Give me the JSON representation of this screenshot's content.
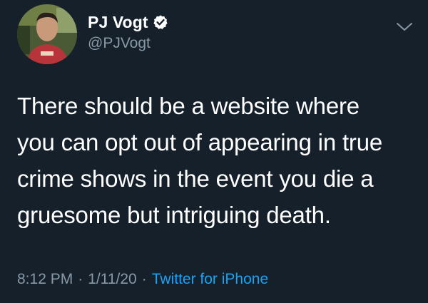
{
  "tweet": {
    "author": {
      "display_name": "PJ Vogt",
      "handle": "@PJVogt",
      "verified": true,
      "avatar_icon": "profile-photo"
    },
    "text_lines": [
      "There should be a website where",
      "you can opt out of appearing in true",
      "crime shows in the event you die a",
      "gruesome but intriguing death."
    ],
    "time": "8:12 PM",
    "separator": "·",
    "date": "1/11/20",
    "source": "Twitter for iPhone",
    "menu_icon": "chevron-down-icon"
  },
  "colors": {
    "background": "#15202b",
    "text": "#ffffff",
    "secondary_text": "#8899a6",
    "link": "#1da1f2",
    "verified_badge": "#ffffff"
  }
}
